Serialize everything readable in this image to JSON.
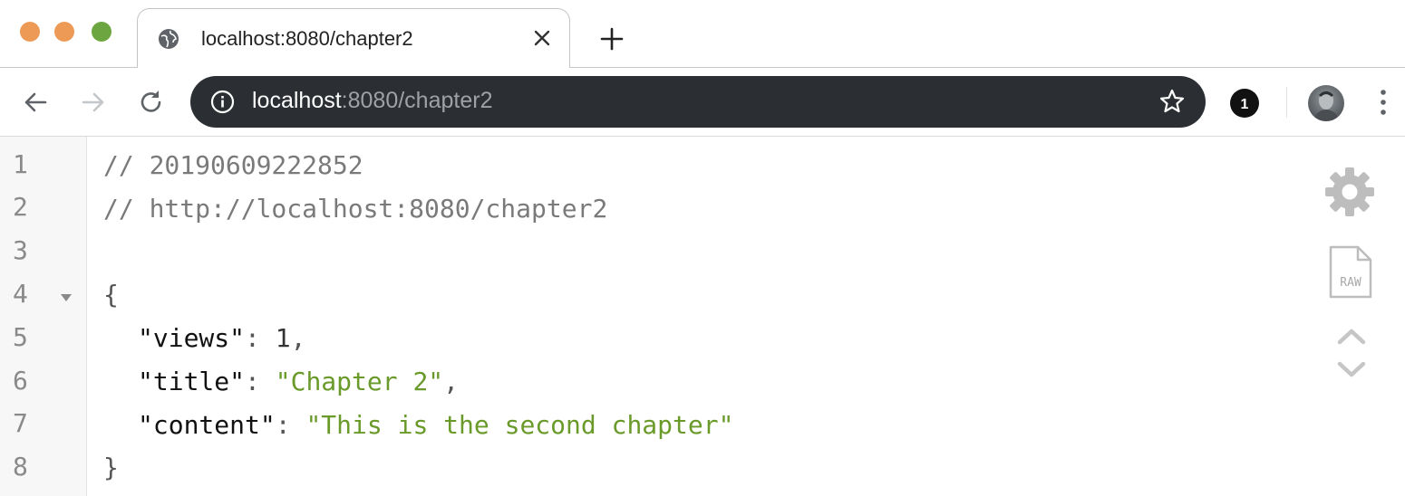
{
  "window": {
    "tab": {
      "title": "localhost:8080/chapter2",
      "favicon": "globe-icon"
    }
  },
  "toolbar": {
    "url_host": "localhost",
    "url_rest": ":8080/chapter2",
    "extension_badge": "1"
  },
  "viewer": {
    "line_numbers": [
      "1",
      "2",
      "3",
      "4",
      "5",
      "6",
      "7",
      "8"
    ],
    "comment1": "// 20190609222852",
    "comment2": "// http://localhost:8080/chapter2",
    "open_brace": "{",
    "close_brace": "}",
    "entries": [
      {
        "key": "\"views\"",
        "value": "1",
        "type": "number",
        "trail": ","
      },
      {
        "key": "\"title\"",
        "value": "\"Chapter 2\"",
        "type": "string",
        "trail": ","
      },
      {
        "key": "\"content\"",
        "value": "\"This is the second chapter\"",
        "type": "string",
        "trail": ""
      }
    ],
    "raw_label": "RAW"
  },
  "colors": {
    "string": "#6a9a2a",
    "omnibox": "#2b2f33",
    "traffic_red": "#ec9a56",
    "traffic_yellow": "#ec9a56",
    "traffic_green": "#6da640"
  }
}
